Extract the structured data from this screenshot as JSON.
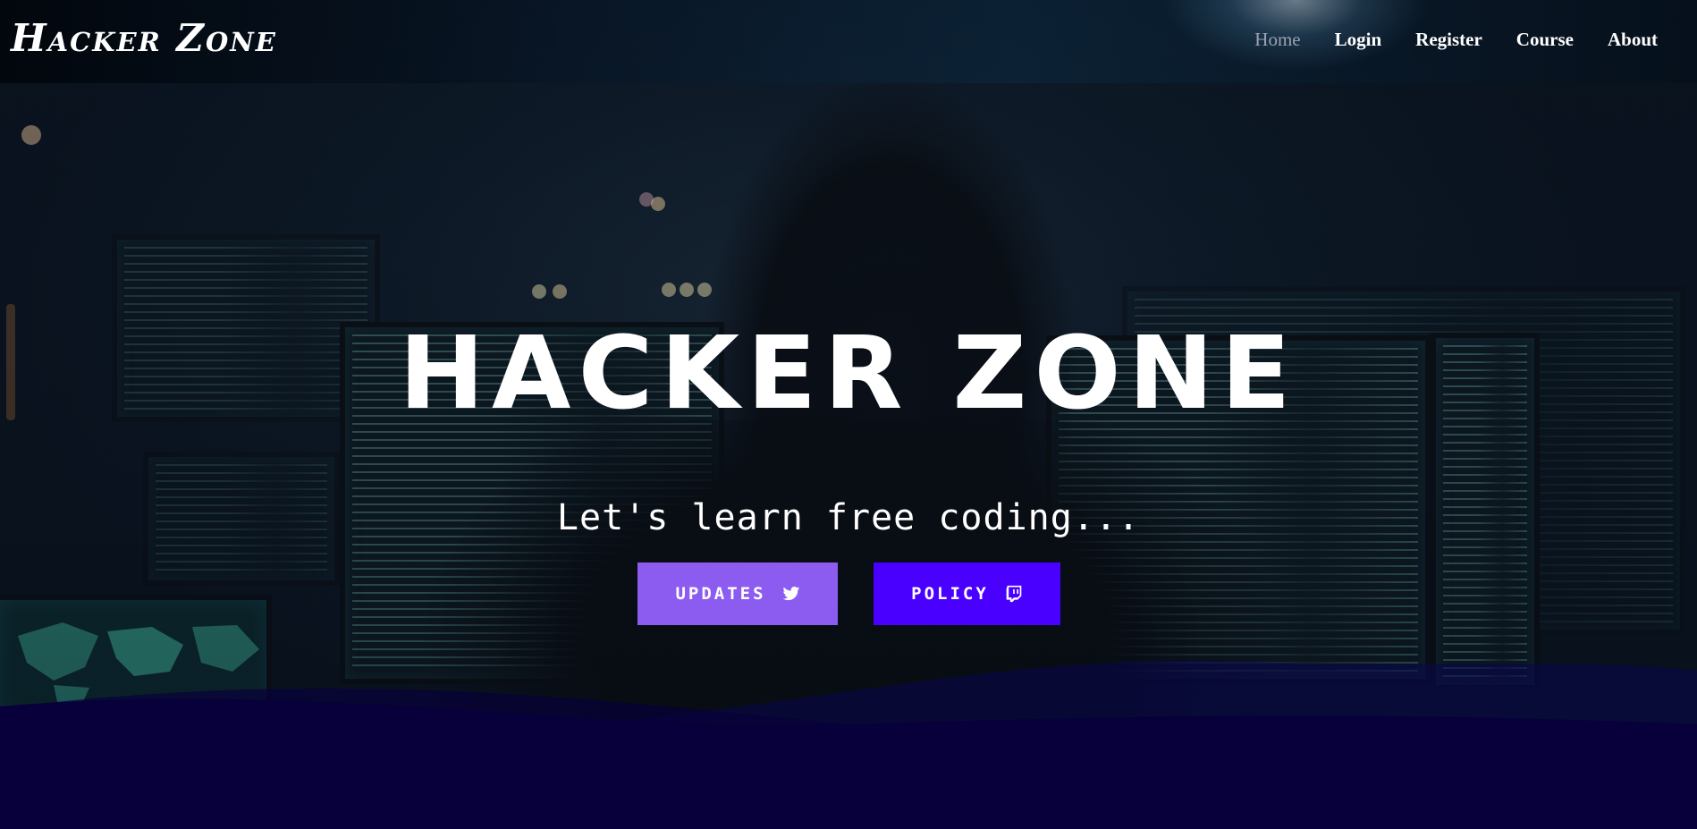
{
  "brand": {
    "name": "Hacker Zone"
  },
  "nav": {
    "items": [
      {
        "label": "Home",
        "active": true
      },
      {
        "label": "Login"
      },
      {
        "label": "Register"
      },
      {
        "label": "Course"
      },
      {
        "label": "About"
      }
    ]
  },
  "hero": {
    "title": "HACKER ZONE",
    "subtitle": "Let's learn free coding...",
    "buttons": [
      {
        "label": "UPDATES",
        "icon": "twitter-icon",
        "color": "#8c5cf0"
      },
      {
        "label": "POLICY",
        "icon": "twitch-icon",
        "color": "#4a00ff"
      }
    ]
  },
  "colors": {
    "wave": "#07003a",
    "accent": "#4a00ff"
  }
}
